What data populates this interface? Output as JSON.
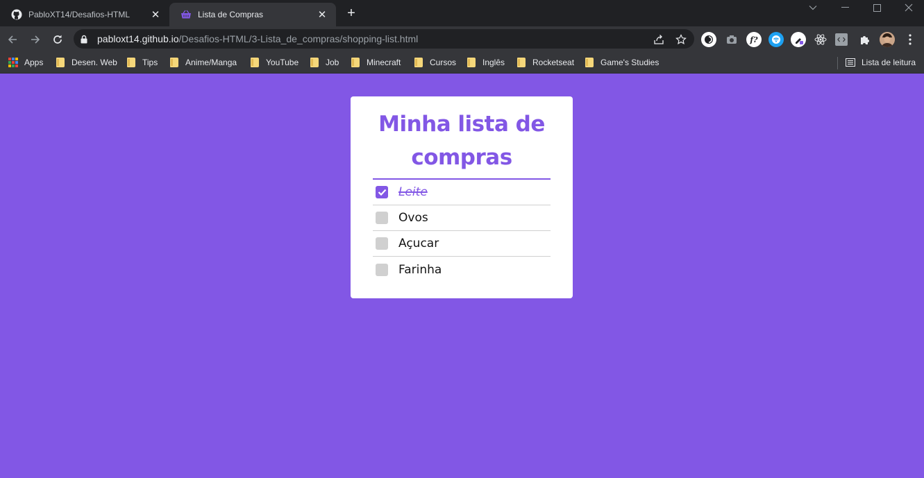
{
  "browser": {
    "tabs": [
      {
        "title": "PabloXT14/Desafios-HTML",
        "active": false,
        "icon": "github-icon"
      },
      {
        "title": "Lista de Compras",
        "active": true,
        "icon": "basket-icon"
      }
    ],
    "address": {
      "host": "pabloxt14.github.io",
      "path": "/Desafios-HTML/3-Lista_de_compras/shopping-list.html"
    },
    "bookmarks": {
      "apps_label": "Apps",
      "items": [
        "Desen. Web",
        "Tips",
        "Anime/Manga",
        "YouTube",
        "Job",
        "Minecraft",
        "Cursos",
        "Inglês",
        "Rocketseat",
        "Game's Studies"
      ],
      "reading_list_label": "Lista de leitura"
    }
  },
  "page": {
    "title": "Minha lista de compras",
    "items": [
      {
        "label": "Leite",
        "checked": true
      },
      {
        "label": "Ovos",
        "checked": false
      },
      {
        "label": "Açucar",
        "checked": false
      },
      {
        "label": "Farinha",
        "checked": false
      }
    ]
  },
  "colors": {
    "accent": "#8257e5",
    "checkbox_unchecked": "#d0d0d0",
    "card_background": "#ffffff"
  }
}
